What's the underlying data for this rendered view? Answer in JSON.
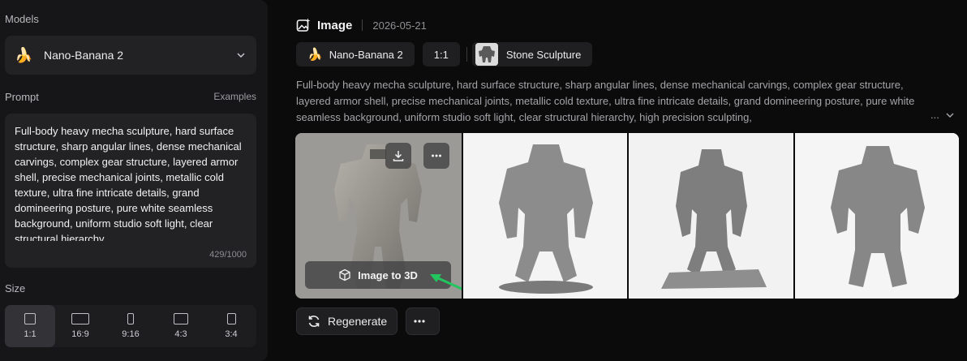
{
  "left": {
    "models_label": "Models",
    "model_name": "Nano-Banana 2",
    "prompt_label": "Prompt",
    "examples_label": "Examples",
    "prompt_text": "Full-body heavy mecha sculpture, hard surface structure, sharp angular lines, dense mechanical carvings, complex gear structure, layered armor shell, precise mechanical joints, metallic cold texture, ultra fine intricate details, grand domineering posture, pure white seamless background, uniform studio soft light, clear structural hierarchy",
    "counter": "429/1000",
    "size_label": "Size",
    "sizes": [
      {
        "label": "1:1"
      },
      {
        "label": "16:9"
      },
      {
        "label": "9:16"
      },
      {
        "label": "4:3"
      },
      {
        "label": "3:4"
      }
    ]
  },
  "main": {
    "title": "Image",
    "date": "2026-05-21",
    "chips": {
      "model": "Nano-Banana 2",
      "ratio": "1:1",
      "style": "Stone Sculpture"
    },
    "description": "Full-body heavy mecha sculpture, hard surface structure, sharp angular lines, dense mechanical carvings, complex gear structure, layered armor shell, precise mechanical joints, metallic cold texture, ultra fine intricate details, grand domineering posture, pure white seamless background, uniform studio soft light, clear structural hierarchy, high precision sculpting,",
    "more_text": "...",
    "image_to_3d": "Image to 3D",
    "regenerate": "Regenerate"
  },
  "colors": {
    "panel": "#161618",
    "accent_arrow": "#22c55e"
  }
}
